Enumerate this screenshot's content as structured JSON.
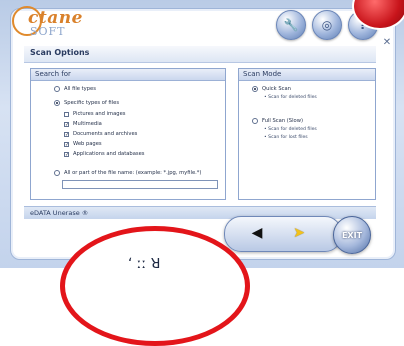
{
  "app": {
    "logo_line1": "ctane",
    "logo_line2": "SOFT",
    "header_buttons": [
      {
        "icon": "tools-icon",
        "glyph": "🔧"
      },
      {
        "icon": "search-scan-icon",
        "glyph": "◎"
      },
      {
        "icon": "help-icon",
        "glyph": "?"
      }
    ],
    "close_glyph": "✕"
  },
  "title": "Scan Options",
  "search_for": {
    "header": "Search for",
    "all_file_types": "All file types",
    "specific_types": "Specific types of files",
    "types": [
      {
        "label": "Pictures and images",
        "checked": false
      },
      {
        "label": "Multimedia",
        "checked": true
      },
      {
        "label": "Documents and archives",
        "checked": true
      },
      {
        "label": "Web pages",
        "checked": true
      },
      {
        "label": "Applications and databases",
        "checked": true
      }
    ],
    "file_name_label": "All or part of the file name: (example: *.jpg, myfile.*)",
    "file_name_value": ""
  },
  "scan_mode": {
    "header": "Scan Mode",
    "quick_scan": "Quick Scan",
    "quick_scan_desc": "• Scan for deleted files",
    "full_scan": "Full Scan (Slow)",
    "full_scan_desc1": "• Scan for deleted files",
    "full_scan_desc2": "• Scan for lost files"
  },
  "footer": {
    "product": "eDATA Unerase ®",
    "back_glyph": "◀",
    "next_glyph": "➤",
    "exit_label": "EXIT"
  },
  "overlay": {
    "partial_text": "ʻ ːː ꓤ"
  }
}
